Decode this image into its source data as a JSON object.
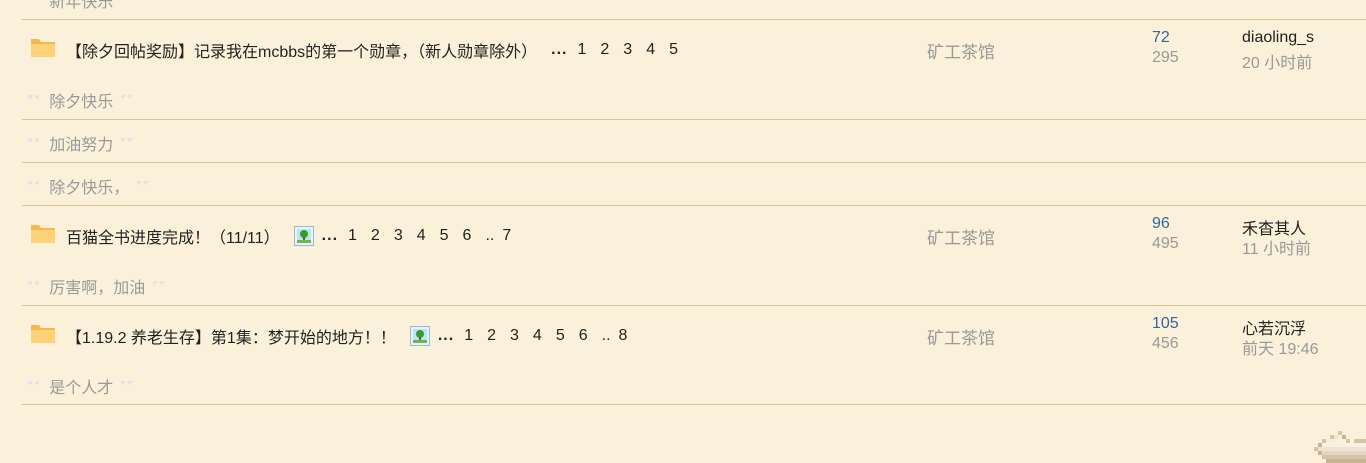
{
  "top_quote": {
    "text": "新年快乐"
  },
  "threads": [
    {
      "title": "【除夕回帖奖励】记录我在mcbbs的第一个勋章，（新人勋章除外）",
      "has_image": false,
      "dots": "...",
      "pages": [
        "1",
        "2",
        "3",
        "4",
        "5"
      ],
      "forum": "矿工茶馆",
      "replies": "72",
      "views": "295",
      "last_user": "diaoling_s",
      "last_time": "20 小时前",
      "quotes": [
        "除夕快乐",
        "加油努力",
        "除夕快乐，"
      ]
    },
    {
      "title": "百猫全书进度完成！（11/11）",
      "has_image": true,
      "dots": "...",
      "pages": [
        "1",
        "2",
        "3",
        "4",
        "5",
        "6",
        "..",
        "7"
      ],
      "forum": "矿工茶馆",
      "replies": "96",
      "views": "495",
      "last_user": "禾杳其人",
      "last_time": "11 小时前",
      "quotes": [
        "厉害啊，加油"
      ]
    },
    {
      "title": "【1.19.2 养老生存】第1集：梦开始的地方！！",
      "has_image": true,
      "dots": "...",
      "pages": [
        "1",
        "2",
        "3",
        "4",
        "5",
        "6",
        "..",
        "8"
      ],
      "forum": "矿工茶馆",
      "replies": "105",
      "views": "456",
      "last_user": "心若沉浮",
      "last_time": "前天 19:46",
      "quotes": [
        "是个人才"
      ]
    }
  ],
  "icons": {
    "folder": "folder-icon",
    "image": "image-attachment-icon",
    "quote_open": "quote-open-icon",
    "quote_close": "quote-close-icon"
  },
  "colors": {
    "background": "#fbf1da",
    "separator": "#dcc49f",
    "replies": "#336699",
    "muted": "#999999"
  }
}
